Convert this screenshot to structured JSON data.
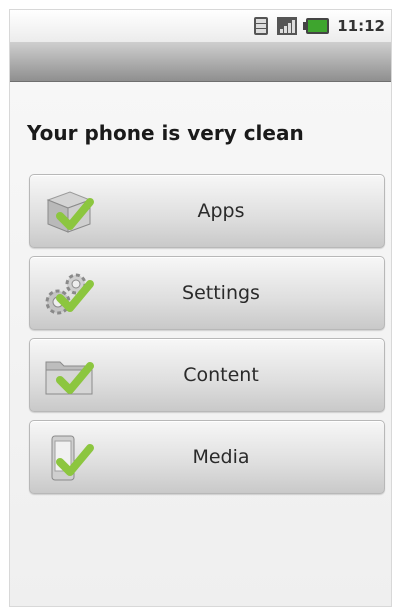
{
  "status_bar": {
    "time": "11:12",
    "icons": [
      "sync-icon",
      "signal-icon",
      "battery-icon"
    ]
  },
  "main": {
    "headline": "Your phone is very clean",
    "buttons": [
      {
        "label": "Apps",
        "icon": "apps-box-check-icon"
      },
      {
        "label": "Settings",
        "icon": "settings-gear-check-icon"
      },
      {
        "label": "Content",
        "icon": "content-folder-check-icon"
      },
      {
        "label": "Media",
        "icon": "media-phone-check-icon"
      }
    ]
  },
  "colors": {
    "check_green": "#8cc63f",
    "title_bar": "#a8a8a8",
    "battery_green": "#3ea52e"
  }
}
